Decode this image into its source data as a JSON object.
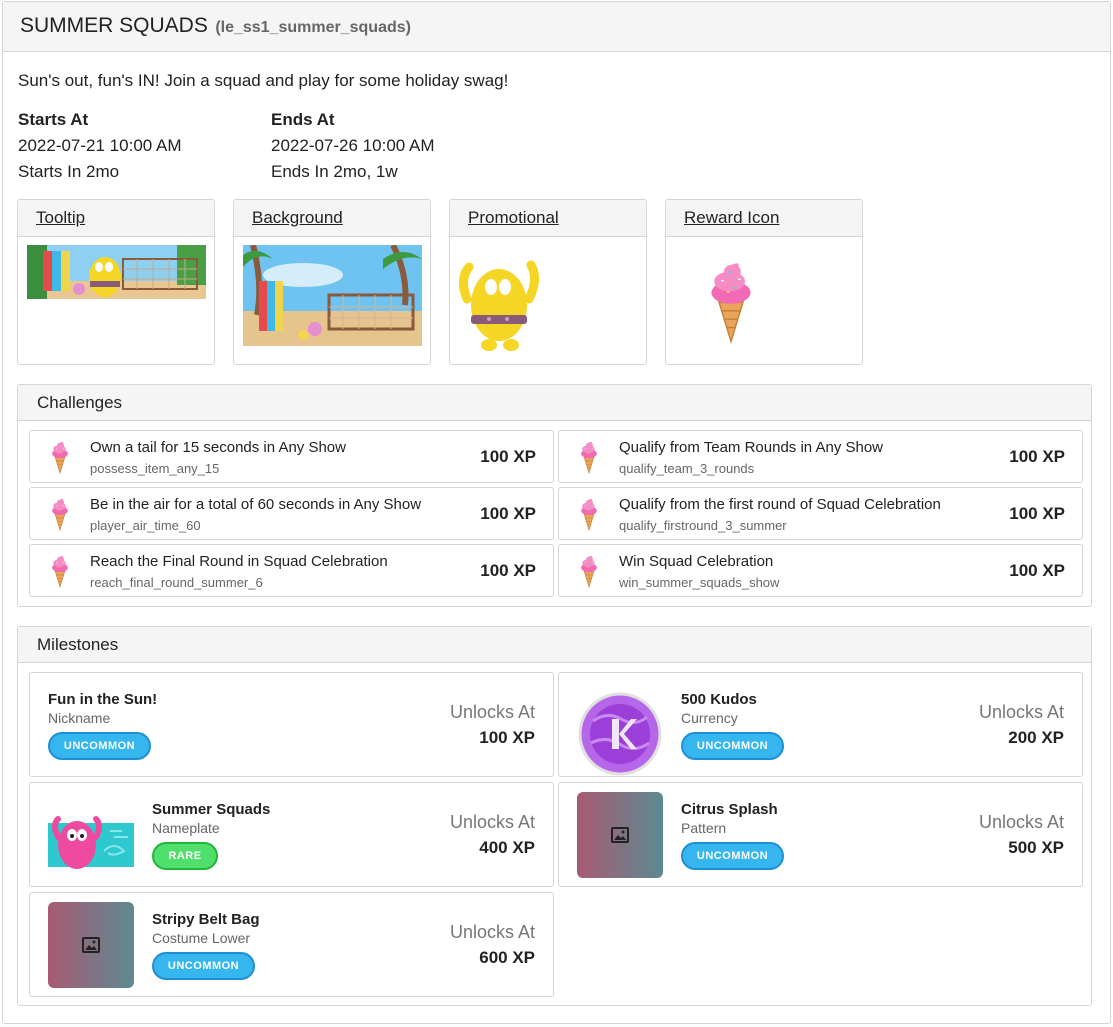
{
  "header": {
    "title": "SUMMER SQUADS",
    "id": "(le_ss1_summer_squads)"
  },
  "intro": "Sun's out, fun's IN! Join a squad and play for some holiday swag!",
  "dates": {
    "start_label": "Starts At",
    "start_value": "2022-07-21 10:00 AM",
    "start_rel": "Starts In 2mo",
    "end_label": "Ends At",
    "end_value": "2022-07-26 10:00 AM",
    "end_rel": "Ends In 2mo, 1w"
  },
  "images": [
    {
      "label": "Tooltip"
    },
    {
      "label": "Background"
    },
    {
      "label": "Promotional"
    },
    {
      "label": "Reward Icon"
    }
  ],
  "challenges": {
    "title": "Challenges",
    "items": [
      {
        "title": "Own a tail for 15 seconds in Any Show",
        "id": "possess_item_any_15",
        "xp": "100 XP"
      },
      {
        "title": "Qualify from Team Rounds in Any Show",
        "id": "qualify_team_3_rounds",
        "xp": "100 XP"
      },
      {
        "title": "Be in the air for a total of 60 seconds in Any Show",
        "id": "player_air_time_60",
        "xp": "100 XP"
      },
      {
        "title": "Qualify from the first round of Squad Celebration",
        "id": "qualify_firstround_3_summer",
        "xp": "100 XP"
      },
      {
        "title": "Reach the Final Round in Squad Celebration",
        "id": "reach_final_round_summer_6",
        "xp": "100 XP"
      },
      {
        "title": "Win Squad Celebration",
        "id": "win_summer_squads_show",
        "xp": "100 XP"
      }
    ]
  },
  "milestones": {
    "title": "Milestones",
    "unlock_label": "Unlocks At",
    "items": [
      {
        "name": "Fun in the Sun!",
        "type": "Nickname",
        "rarity": "UNCOMMON",
        "xp": "100 XP"
      },
      {
        "name": "500 Kudos",
        "type": "Currency",
        "rarity": "UNCOMMON",
        "xp": "200 XP"
      },
      {
        "name": "Summer Squads",
        "type": "Nameplate",
        "rarity": "RARE",
        "xp": "400 XP"
      },
      {
        "name": "Citrus Splash",
        "type": "Pattern",
        "rarity": "UNCOMMON",
        "xp": "500 XP"
      },
      {
        "name": "Stripy Belt Bag",
        "type": "Costume Lower",
        "rarity": "UNCOMMON",
        "xp": "600 XP"
      }
    ]
  },
  "colors": {
    "uncommon": "#36b6ee",
    "rare": "#4ee06a",
    "kudos": "#9b3fd8",
    "icecream_pink": "#f26ab4",
    "cone": "#e9a55a"
  }
}
